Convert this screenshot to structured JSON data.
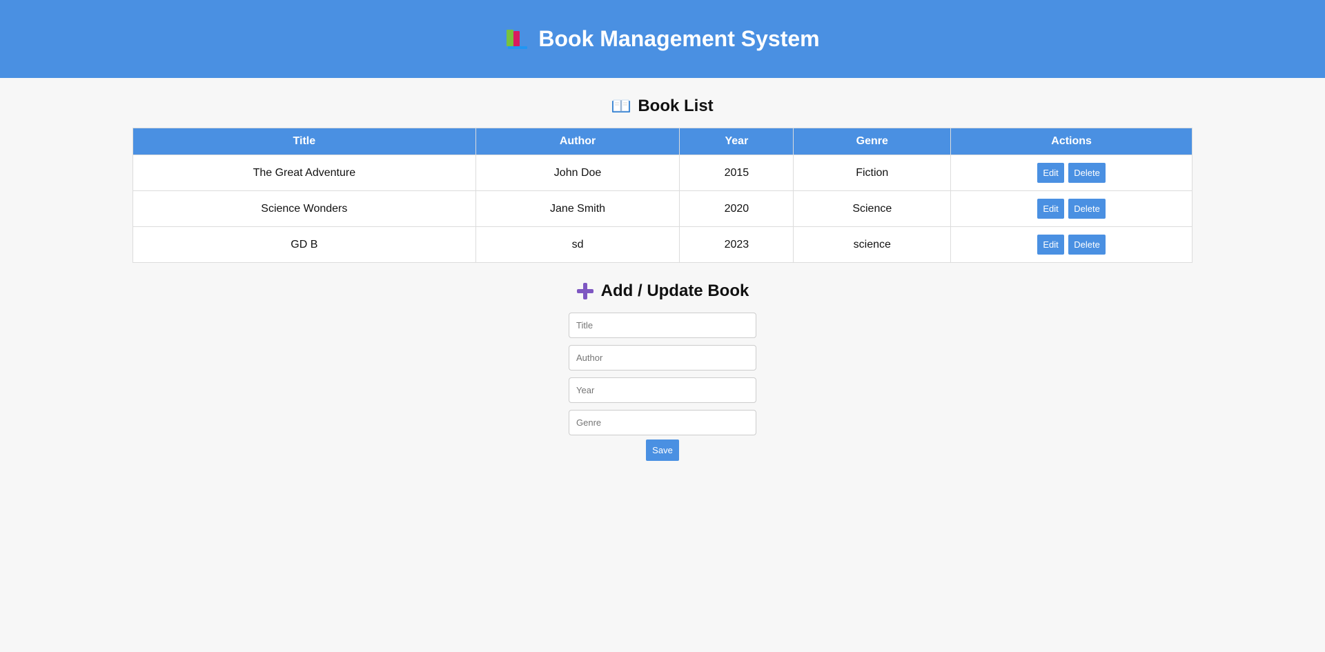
{
  "header": {
    "title": "Book Management System",
    "icon": "books-icon",
    "background": "#4a90e2"
  },
  "book_list": {
    "title": "Book List",
    "icon": "open-book-icon",
    "columns": [
      "Title",
      "Author",
      "Year",
      "Genre",
      "Actions"
    ],
    "rows": [
      {
        "title": "The Great Adventure",
        "author": "John Doe",
        "year": "2015",
        "genre": "Fiction",
        "edit_label": "Edit",
        "delete_label": "Delete"
      },
      {
        "title": "Science Wonders",
        "author": "Jane Smith",
        "year": "2020",
        "genre": "Science",
        "edit_label": "Edit",
        "delete_label": "Delete"
      },
      {
        "title": "GD B",
        "author": "sd",
        "year": "2023",
        "genre": "science",
        "edit_label": "Edit",
        "delete_label": "Delete"
      }
    ]
  },
  "form": {
    "title": "Add / Update Book",
    "icon": "plus-icon",
    "title_field": {
      "value": "",
      "placeholder": "Title"
    },
    "author_field": {
      "value": "",
      "placeholder": "Author"
    },
    "year_field": {
      "value": "",
      "placeholder": "Year"
    },
    "genre_field": {
      "value": "",
      "placeholder": "Genre"
    },
    "save_label": "Save"
  },
  "colors": {
    "accent": "#4a90e2",
    "page_background": "#f7f7f7",
    "plus_icon": "#7e57c2"
  }
}
